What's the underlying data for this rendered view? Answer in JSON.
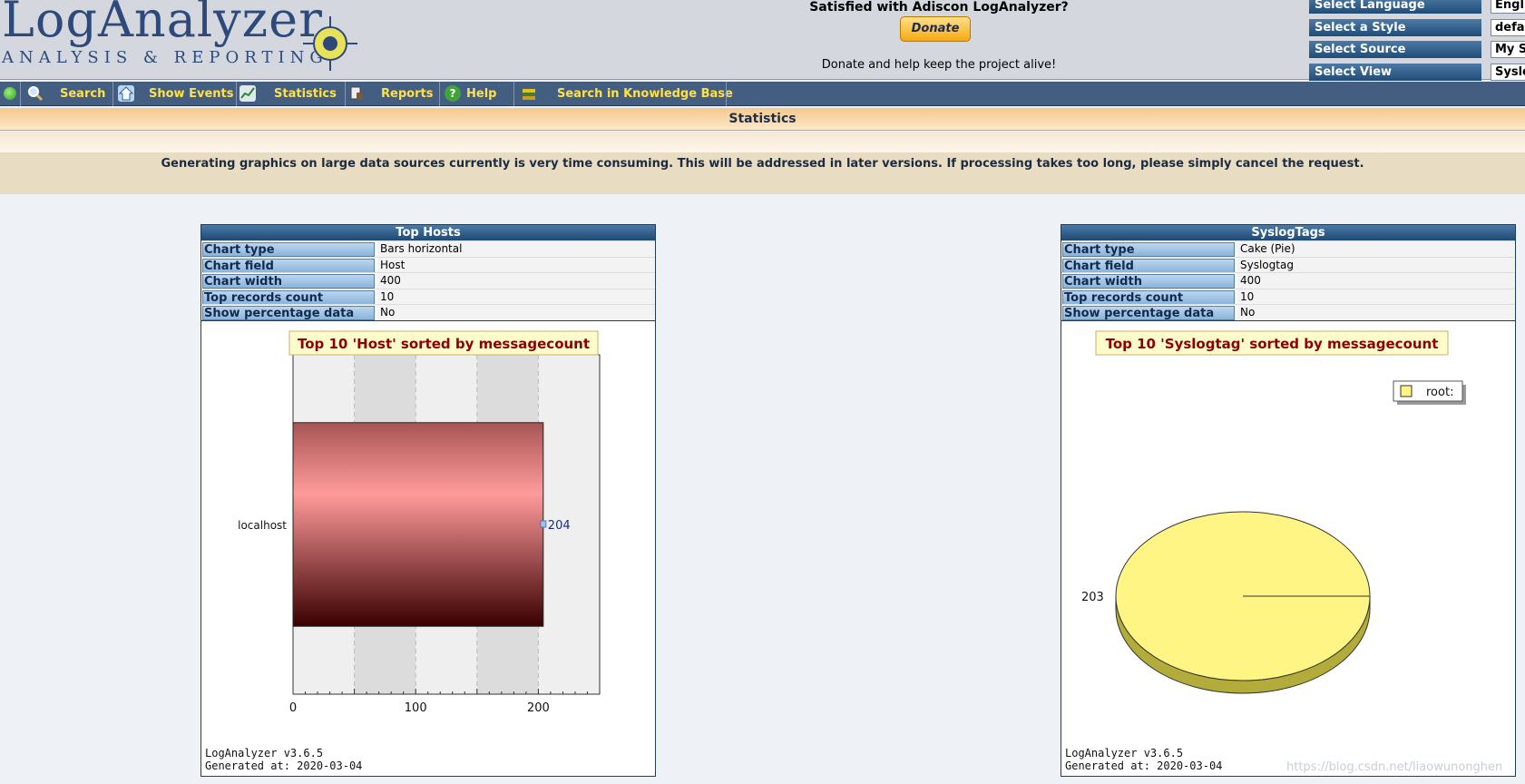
{
  "header": {
    "logo_title": "LogAnalyzer",
    "logo_subtitle": "ANALYSIS & REPORTING",
    "donate_title": "Satisfied with Adiscon LogAnalyzer?",
    "donate_button": "Donate",
    "donate_note": "Donate and help keep the project alive!",
    "selectors": [
      {
        "label": "Select Language",
        "value": "Engli"
      },
      {
        "label": "Select a Style",
        "value": "defau"
      },
      {
        "label": "Select Source",
        "value": "My Sy"
      },
      {
        "label": "Select View",
        "value": "Syslo"
      }
    ]
  },
  "nav": {
    "search": "Search",
    "show_events": "Show Events",
    "statistics": "Statistics",
    "reports": "Reports",
    "help": "Help",
    "knowledge_base": "Search in Knowledge Base"
  },
  "page": {
    "title": "Statistics",
    "notice": "Generating graphics on large data sources currently is very time consuming. This will be addressed in later versions. If processing takes too long, please simply cancel the request."
  },
  "panels": [
    {
      "title": "Top Hosts",
      "props": [
        {
          "label": "Chart type",
          "value": "Bars horizontal"
        },
        {
          "label": "Chart field",
          "value": "Host"
        },
        {
          "label": "Chart width",
          "value": "400"
        },
        {
          "label": "Top records count",
          "value": "10"
        },
        {
          "label": "Show percentage data",
          "value": "No"
        }
      ],
      "footer_version": "LogAnalyzer v3.6.5",
      "footer_generated": "Generated at: 2020-03-04"
    },
    {
      "title": "SyslogTags",
      "props": [
        {
          "label": "Chart type",
          "value": "Cake (Pie)"
        },
        {
          "label": "Chart field",
          "value": "Syslogtag"
        },
        {
          "label": "Chart width",
          "value": "400"
        },
        {
          "label": "Top records count",
          "value": "10"
        },
        {
          "label": "Show percentage data",
          "value": "No"
        }
      ],
      "footer_version": "LogAnalyzer v3.6.5",
      "footer_generated": "Generated at: 2020-03-04"
    }
  ],
  "chart_data": [
    {
      "type": "bar",
      "orientation": "horizontal",
      "title": "Top 10 'Host' sorted by messagecount",
      "categories": [
        "localhost"
      ],
      "values": [
        204
      ],
      "xlim": [
        0,
        250
      ],
      "xticks": [
        0,
        100,
        200
      ],
      "bar_color": "#c45a5a"
    },
    {
      "type": "pie",
      "title": "Top 10 'Syslogtag' sorted by messagecount",
      "categories": [
        "root:"
      ],
      "values": [
        203
      ],
      "legend": "top-right",
      "slice_color": "#fff585"
    }
  ],
  "watermark": "https://blog.csdn.net/liaowunonghen"
}
